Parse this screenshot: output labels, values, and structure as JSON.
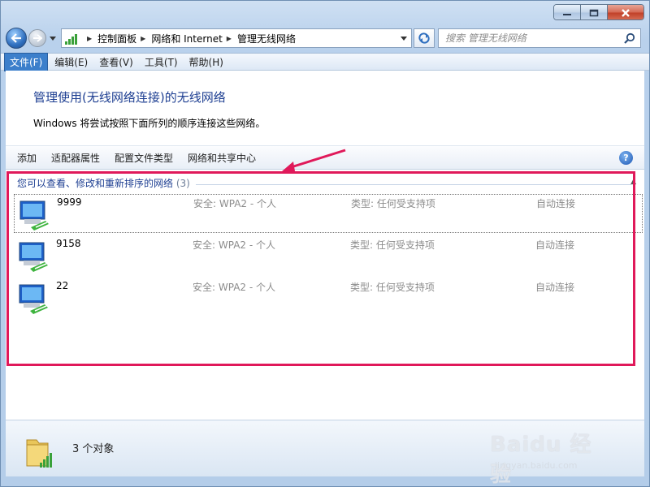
{
  "window": {
    "controls": [
      "minimize",
      "maximize",
      "close"
    ]
  },
  "address": {
    "breadcrumbs": [
      "控制面板",
      "网络和 Internet",
      "管理无线网络"
    ]
  },
  "search": {
    "placeholder": "搜索 管理无线网络"
  },
  "menu": {
    "items": [
      {
        "label": "文件(F)",
        "active": true
      },
      {
        "label": "编辑(E)",
        "active": false
      },
      {
        "label": "查看(V)",
        "active": false
      },
      {
        "label": "工具(T)",
        "active": false
      },
      {
        "label": "帮助(H)",
        "active": false
      }
    ]
  },
  "header": {
    "title": "管理使用(无线网络连接)的无线网络",
    "description": "Windows 将尝试按照下面所列的顺序连接这些网络。"
  },
  "toolbar": {
    "items": [
      "添加",
      "适配器属性",
      "配置文件类型",
      "网络和共享中心"
    ],
    "help": "?"
  },
  "group": {
    "label": "您可以查看、修改和重新排序的网络",
    "count": "(3)"
  },
  "networks": [
    {
      "name": "9999",
      "security": "安全: WPA2 - 个人",
      "type": "类型: 任何受支持项",
      "mode": "自动连接",
      "selected": true
    },
    {
      "name": "9158",
      "security": "安全: WPA2 - 个人",
      "type": "类型: 任何受支持项",
      "mode": "自动连接",
      "selected": false
    },
    {
      "name": "22",
      "security": "安全: WPA2 - 个人",
      "type": "类型: 任何受支持项",
      "mode": "自动连接",
      "selected": false
    }
  ],
  "status": {
    "count_text": "3 个对象"
  },
  "watermark": {
    "main": "Baidu 经验",
    "sub": "jingyan.baidu.com"
  },
  "colors": {
    "accent": "#1e3f92",
    "annotation": "#e0195a",
    "menu_active": "#3c7fcb"
  }
}
